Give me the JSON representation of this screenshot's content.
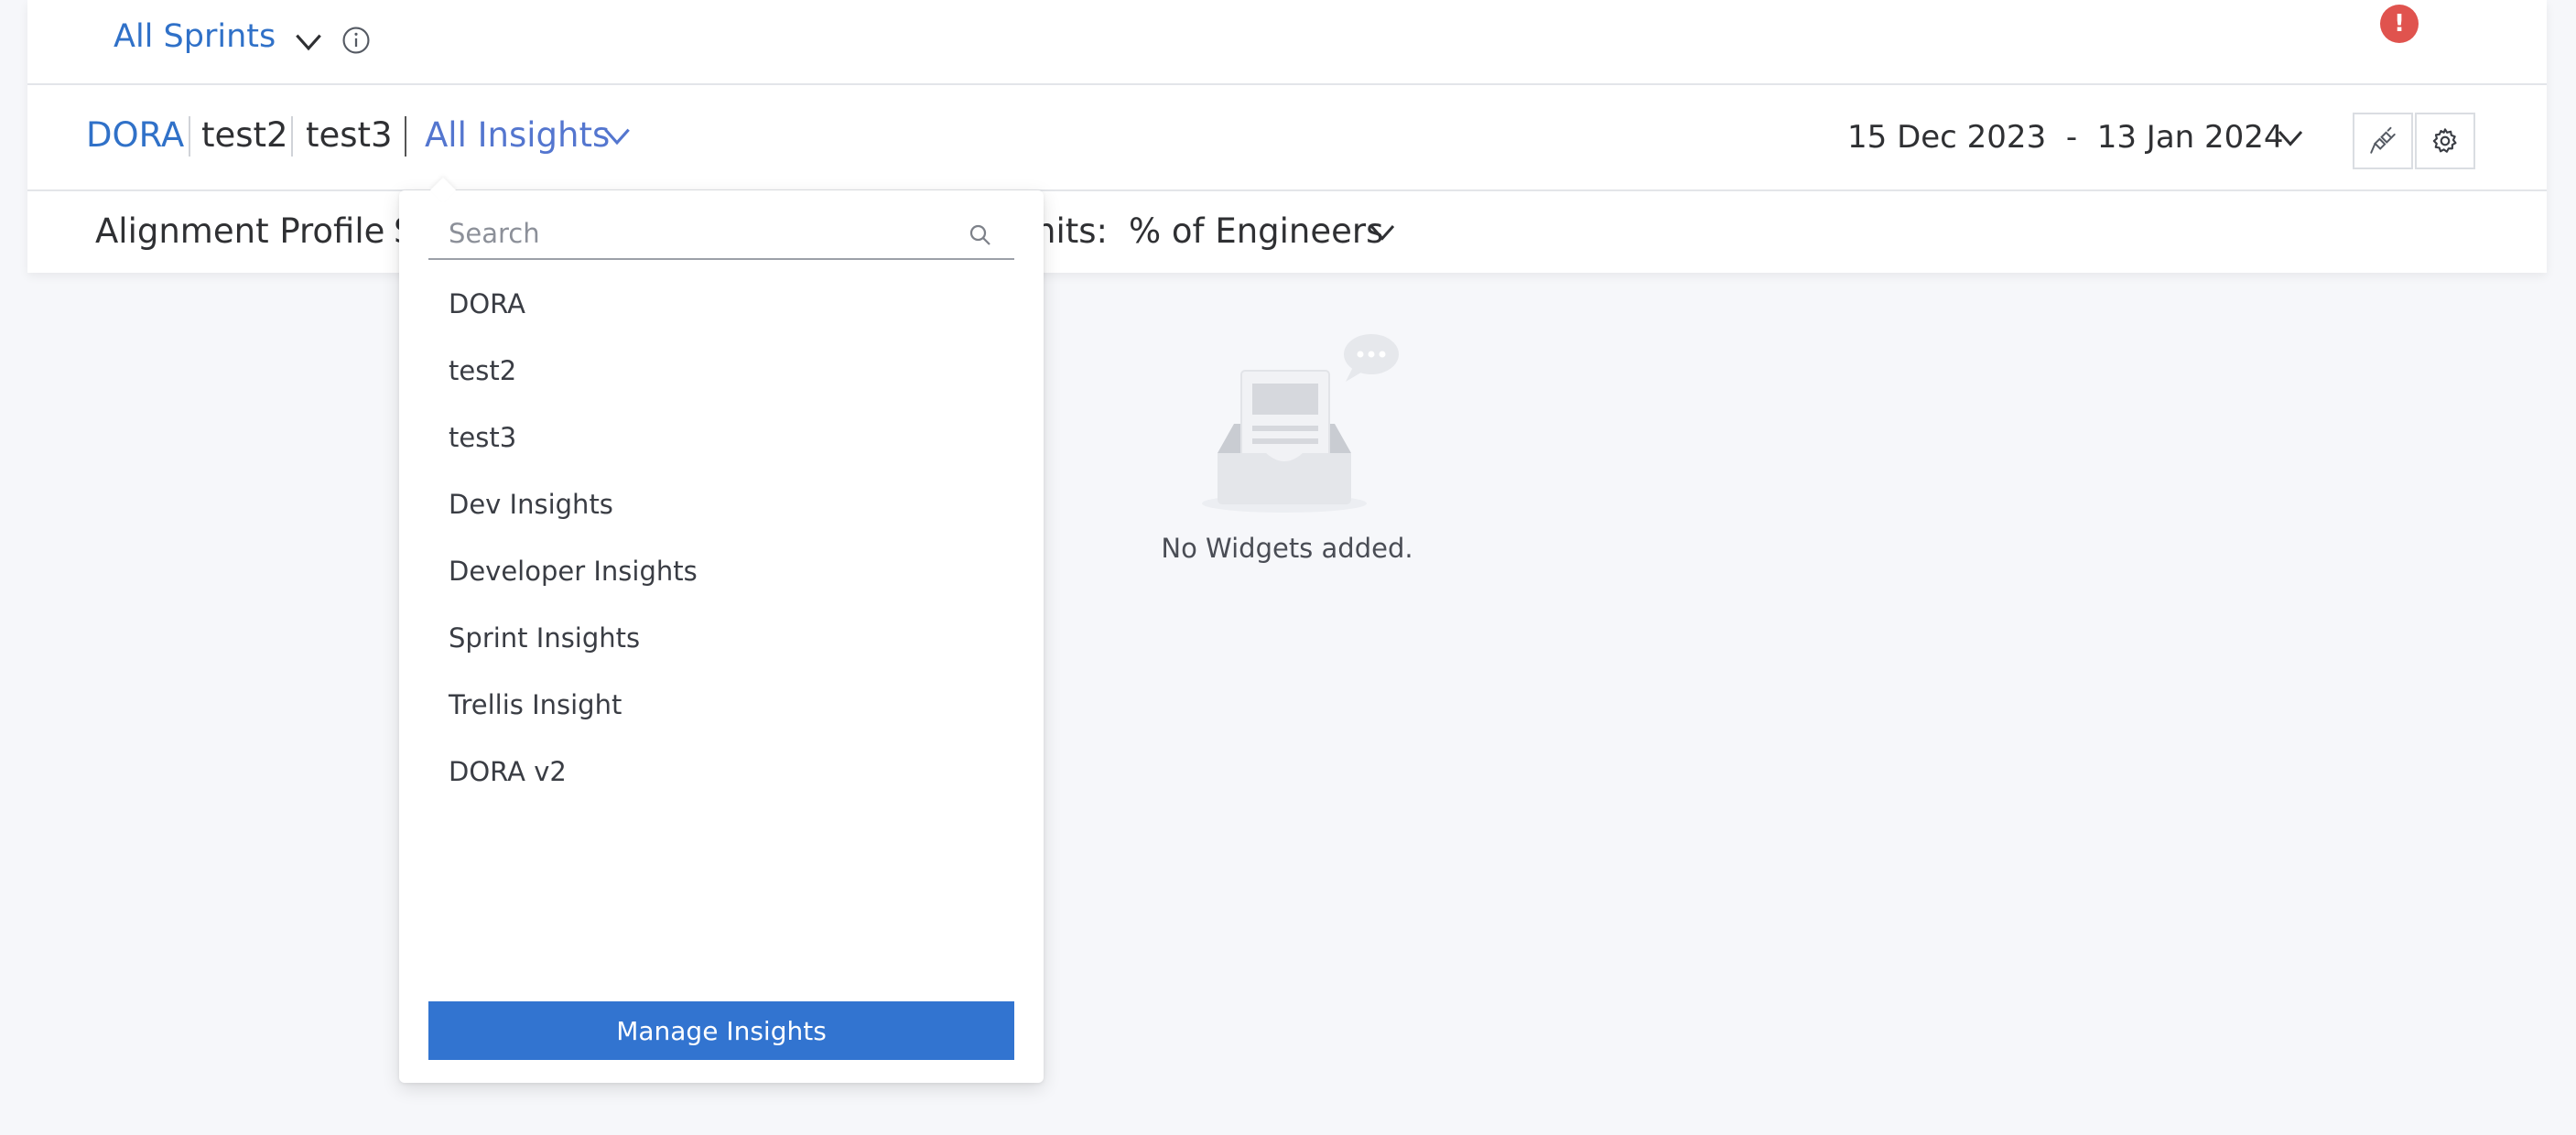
{
  "filters": {
    "sprint_label": "All Sprints"
  },
  "breadcrumb": {
    "items": [
      "DORA",
      "test2",
      "test3"
    ],
    "insights_label": "All Insights"
  },
  "date_range": {
    "start": "15 Dec 2023",
    "separator": "-",
    "end": "13 Jan 2024"
  },
  "notification": {
    "badge": "!"
  },
  "alignment": {
    "profile_label": "Alignment Profile :",
    "profile_value": "S",
    "units_label": "nits:",
    "units_value": "% of Engineers"
  },
  "empty_state": {
    "text": "No Widgets added."
  },
  "insights_dropdown": {
    "search_placeholder": "Search",
    "items": [
      "DORA",
      "test2",
      "test3",
      "Dev Insights",
      "Developer Insights",
      "Sprint Insights",
      "Trellis Insight",
      "DORA v2"
    ],
    "manage_label": "Manage Insights"
  },
  "colors": {
    "accent": "#3071c8",
    "button": "#3274d0",
    "badge": "#e0534e"
  }
}
